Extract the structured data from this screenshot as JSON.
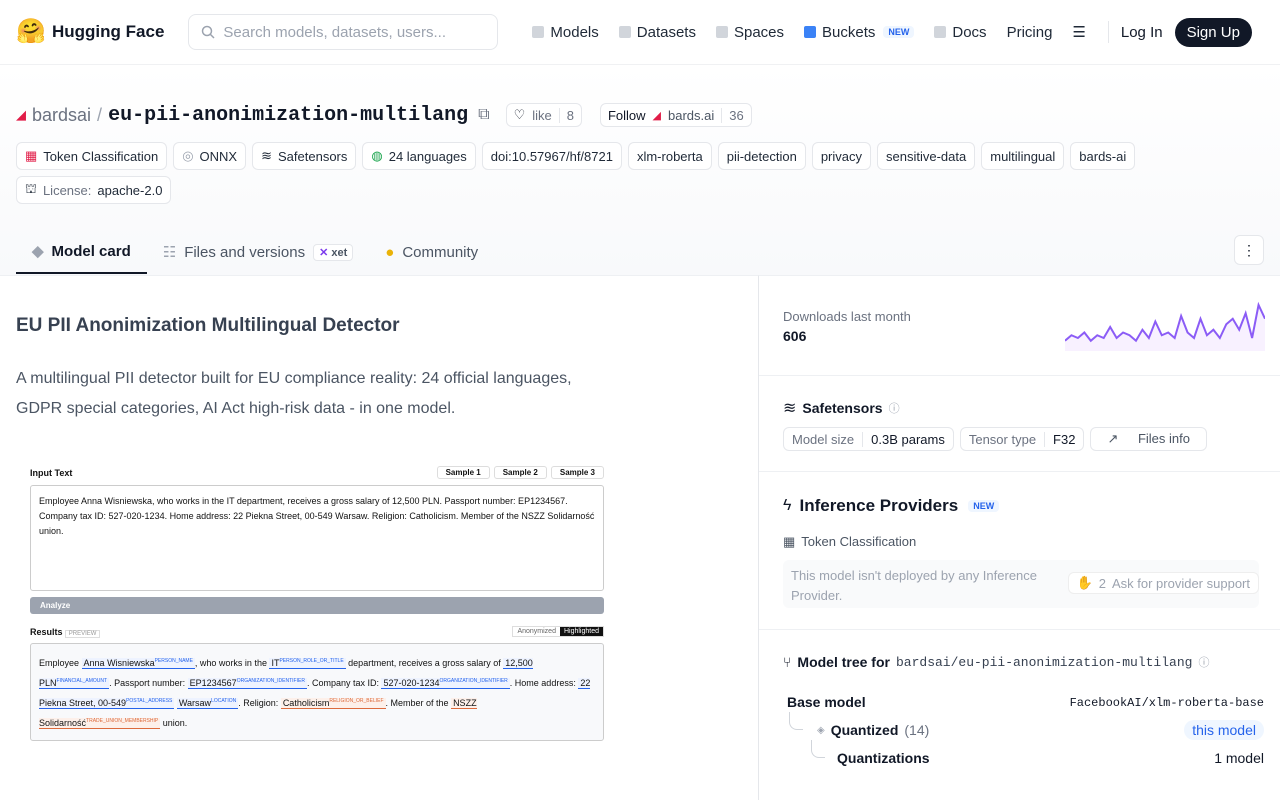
{
  "nav": {
    "brand": "Hugging Face",
    "search_placeholder": "Search models, datasets, users...",
    "links": [
      {
        "label": "Models"
      },
      {
        "label": "Datasets"
      },
      {
        "label": "Spaces"
      },
      {
        "label": "Buckets",
        "badge": "NEW"
      },
      {
        "label": "Docs"
      },
      {
        "label": "Pricing"
      }
    ],
    "login": "Log In",
    "signup": "Sign Up"
  },
  "repo": {
    "org": "bardsai",
    "name": "eu-pii-anonimization-multilang",
    "like_label": "like",
    "likes": "8",
    "follow_label": "Follow",
    "follow_org": "bards.ai",
    "followers": "36"
  },
  "tags": [
    "Token Classification",
    "ONNX",
    "Safetensors",
    "24 languages",
    "doi:10.57967/hf/8721",
    "xlm-roberta",
    "pii-detection",
    "privacy",
    "sensitive-data",
    "multilingual",
    "bards-ai"
  ],
  "license": {
    "label": "License:",
    "value": "apache-2.0"
  },
  "tabs": {
    "model_card": "Model card",
    "files": "Files and versions",
    "xet": "xet",
    "community": "Community"
  },
  "card": {
    "title": "EU PII Anonimization Multilingual Detector",
    "description": "A multilingual PII detector built for EU compliance reality: 24 official languages, GDPR special categories, AI Act high-risk data - in one model."
  },
  "demo": {
    "input_label": "Input Text",
    "samples": [
      "Sample 1",
      "Sample 2",
      "Sample 3"
    ],
    "input_text": "Employee Anna Wisniewska, who works in the IT department, receives a gross salary of 12,500 PLN. Passport number: EP1234567. Company tax ID: 527-020-1234. Home address: 22 Piekna Street, 00-549 Warsaw. Religion: Catholicism. Member of the NSZZ Solidarność union.",
    "analyze": "Analyze",
    "results_label": "Results",
    "preview": "PREVIEW",
    "mode_a": "Anonymized",
    "mode_b": "Highlighted",
    "r": {
      "t1": "Employee",
      "e1": "Anna Wisniewska",
      "l1": "PERSON_NAME",
      "t2": ", who works in the",
      "e2": "IT",
      "l2": "PERSON_ROLE_OR_TITLE",
      "t3": "department, receives a gross salary of",
      "e3": "12,500 PLN",
      "l3": "FINANCIAL_AMOUNT",
      "t4": ". Passport number:",
      "e4": "EP1234567",
      "l4": "ORGANIZATION_IDENTIFIER",
      "t5": ". Company tax ID:",
      "e5": "527-020-1234",
      "l5": "ORGANIZATION_IDENTIFIER",
      "t6": ". Home address:",
      "e6": "22 Piekna Street, 00-549",
      "l6": "POSTAL_ADDRESS",
      "e7": "Warsaw",
      "l7": "LOCATION",
      "t7": ". Religion:",
      "e8": "Catholicism",
      "l8": "RELIGION_OR_BELIEF",
      "t8": ". Member of the",
      "e9": "NSZZ Solidarność",
      "l9": "TRADE_UNION_MEMBERSHIP",
      "t9": "union."
    }
  },
  "downloads": {
    "label": "Downloads last month",
    "value": "606",
    "trend": [
      3,
      5,
      4,
      6,
      3,
      5,
      4,
      8,
      4,
      6,
      5,
      3,
      7,
      4,
      10,
      5,
      6,
      4,
      12,
      6,
      4,
      11,
      5,
      7,
      4,
      9,
      11,
      7,
      13,
      4,
      16,
      11
    ]
  },
  "safetensors": {
    "title": "Safetensors",
    "model_size_label": "Model size",
    "model_size": "0.3B params",
    "tensor_type_label": "Tensor type",
    "tensor_type": "F32",
    "files_info": "Files info"
  },
  "inference": {
    "title": "Inference Providers",
    "badge": "NEW",
    "task": "Token Classification",
    "note": "This model isn't deployed by any Inference Provider.",
    "votes": "2",
    "ask": "Ask for provider support"
  },
  "tree": {
    "title": "Model tree for",
    "repo": "bardsai/eu-pii-anonimization-multilang",
    "base_label": "Base model",
    "base_value": "FacebookAI/xlm-roberta-base",
    "quantized_label": "Quantized",
    "quantized_count": "(14)",
    "this_model": "this model",
    "quantizations_label": "Quantizations",
    "quantizations_value": "1 model"
  }
}
